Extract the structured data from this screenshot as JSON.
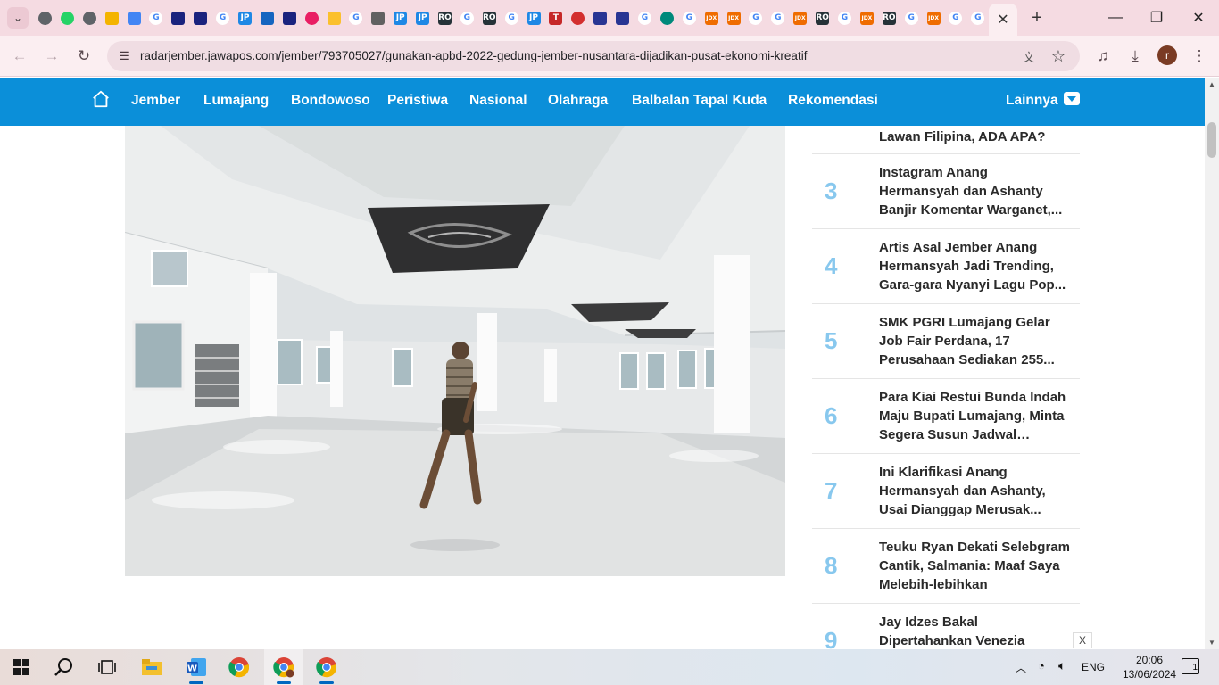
{
  "browser": {
    "active_tab_close": "✕",
    "new_tab": "+",
    "url": "radarjember.jawapos.com/jember/793705027/gunakan-apbd-2022-gedung-jember-nusantara-dijadikan-pusat-ekonomi-kreatif",
    "profile_initial": "r",
    "favicons": [
      {
        "icon": "globe-icon",
        "color": "#5f6368",
        "t": ""
      },
      {
        "icon": "whatsapp-icon",
        "color": "#25d366",
        "t": ""
      },
      {
        "icon": "globe-icon",
        "color": "#5f6368",
        "t": ""
      },
      {
        "icon": "drive-icon",
        "color": "#f4b400",
        "t": ""
      },
      {
        "icon": "docs-icon",
        "color": "#4285f4",
        "t": ""
      },
      {
        "icon": "google-icon",
        "color": "#4285f4",
        "t": "G"
      },
      {
        "icon": "arrow-icon",
        "color": "#1a237e",
        "t": ""
      },
      {
        "icon": "arrow-icon",
        "color": "#1a237e",
        "t": ""
      },
      {
        "icon": "google-icon",
        "color": "#4285f4",
        "t": "G"
      },
      {
        "icon": "jp-icon",
        "color": "#1e88e5",
        "t": "JP"
      },
      {
        "icon": "location-icon",
        "color": "#1565c0",
        "t": ""
      },
      {
        "icon": "arrow-icon",
        "color": "#1a237e",
        "t": ""
      },
      {
        "icon": "circle-icon",
        "color": "#e91e63",
        "t": ""
      },
      {
        "icon": "coin-icon",
        "color": "#fbc02d",
        "t": ""
      },
      {
        "icon": "google-icon",
        "color": "#4285f4",
        "t": "G"
      },
      {
        "icon": "speaker-icon",
        "color": "#616161",
        "t": ""
      },
      {
        "icon": "jp-icon",
        "color": "#1e88e5",
        "t": "JP"
      },
      {
        "icon": "jp-icon",
        "color": "#1e88e5",
        "t": "JP"
      },
      {
        "icon": "ro-icon",
        "color": "#263238",
        "t": "RO"
      },
      {
        "icon": "google-icon",
        "color": "#4285f4",
        "t": "G"
      },
      {
        "icon": "ro-icon",
        "color": "#263238",
        "t": "RO"
      },
      {
        "icon": "google-icon",
        "color": "#4285f4",
        "t": "G"
      },
      {
        "icon": "jp-icon",
        "color": "#1e88e5",
        "t": "JP"
      },
      {
        "icon": "t-icon",
        "color": "#c62828",
        "t": "T"
      },
      {
        "icon": "circle-icon",
        "color": "#d32f2f",
        "t": ""
      },
      {
        "icon": "swoosh-icon",
        "color": "#283593",
        "t": ""
      },
      {
        "icon": "swoosh-icon",
        "color": "#283593",
        "t": ""
      },
      {
        "icon": "google-icon",
        "color": "#4285f4",
        "t": "G"
      },
      {
        "icon": "emblem-icon",
        "color": "#00897b",
        "t": ""
      },
      {
        "icon": "google-icon",
        "color": "#4285f4",
        "t": "G"
      },
      {
        "icon": "jdx-icon",
        "color": "#ef6c00",
        "t": "JDX"
      },
      {
        "icon": "jdx-icon",
        "color": "#ef6c00",
        "t": "JDX"
      },
      {
        "icon": "google-icon",
        "color": "#4285f4",
        "t": "G"
      },
      {
        "icon": "google-icon",
        "color": "#4285f4",
        "t": "G"
      },
      {
        "icon": "jdx-icon",
        "color": "#ef6c00",
        "t": "JDX"
      },
      {
        "icon": "ro-icon",
        "color": "#263238",
        "t": "RO"
      },
      {
        "icon": "google-icon",
        "color": "#4285f4",
        "t": "G"
      },
      {
        "icon": "jdx-icon",
        "color": "#ef6c00",
        "t": "JDX"
      },
      {
        "icon": "ro-icon",
        "color": "#263238",
        "t": "RO"
      },
      {
        "icon": "google-icon",
        "color": "#4285f4",
        "t": "G"
      },
      {
        "icon": "jdx-icon",
        "color": "#ef6c00",
        "t": "JDX"
      },
      {
        "icon": "google-icon",
        "color": "#4285f4",
        "t": "G"
      },
      {
        "icon": "google-icon",
        "color": "#4285f4",
        "t": "G"
      }
    ]
  },
  "nav": {
    "items": [
      "Jember",
      "Lumajang",
      "Bondowoso",
      "Peristiwa",
      "Nasional",
      "Olahraga",
      "Balbalan Tapal Kuda",
      "Rekomendasi"
    ],
    "more": "Lainnya"
  },
  "popular": {
    "partial_title": "Lawan Filipina, ADA APA?",
    "items": [
      {
        "num": "3",
        "title": "Instagram Anang Hermansyah dan Ashanty Banjir Komentar Warganet,..."
      },
      {
        "num": "4",
        "title": "Artis Asal Jember Anang Hermansyah Jadi Trending, Gara-gara Nyanyi Lagu Pop..."
      },
      {
        "num": "5",
        "title": "SMK PGRI Lumajang Gelar Job Fair Perdana, 17 Perusahaan Sediakan 255..."
      },
      {
        "num": "6",
        "title": "Para Kiai Restui Bunda Indah Maju Bupati Lumajang, Minta Segera Susun Jadwal Kelilin..."
      },
      {
        "num": "7",
        "title": "Ini Klarifikasi Anang Hermansyah dan Ashanty, Usai Dianggap Merusak..."
      },
      {
        "num": "8",
        "title": "Teuku Ryan Dekati Selebgram Cantik, Salmania: Maaf Saya Melebih-lebihkan"
      },
      {
        "num": "9",
        "title": "Jay Idzes Bakal Dipertahankan Venezia"
      }
    ],
    "close_ad": "X"
  },
  "taskbar": {
    "lang": "ENG",
    "time": "20:06",
    "date": "13/06/2024",
    "notifications": "1"
  }
}
